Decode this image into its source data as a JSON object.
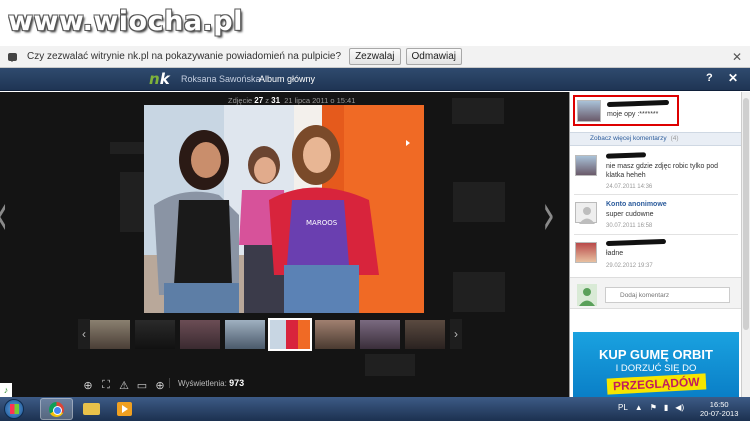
{
  "watermark": "www.wiocha.pl",
  "notification": {
    "message": "Czy zezwalać witrynie nk.pl na pokazywanie powiadomień na pulpicie?",
    "allow_label": "Zezwalaj",
    "deny_label": "Odmawiaj"
  },
  "header": {
    "logo_prefix": "n",
    "logo_suffix": "k",
    "user_name": "Roksana Sawońska",
    "album_label": "Album główny",
    "help_label": "?",
    "close_label": "✕"
  },
  "viewer": {
    "caption_prefix": "Zdjęcie",
    "current": "27",
    "caption_of": "z",
    "total": "31",
    "caption_date": "21 lipca 2011 o 15:41",
    "views_label": "Wyświetlenia:",
    "views_count": "973",
    "prev_arrow": "‹",
    "next_arrow": "›",
    "thumb_prev": "‹",
    "thumb_next": "›"
  },
  "comments": {
    "top": {
      "text": "moje opy :*******"
    },
    "more_label": "Zobacz więcej komentarzy",
    "more_count": "(4)",
    "items": [
      {
        "name": "",
        "text": "nie masz gdzie zdjęc robic tylko pod klatka heheh",
        "date": "24.07.2011 14:36"
      },
      {
        "name": "Konto anonimowe",
        "text": "super cudowne",
        "date": "30.07.2011 16:58"
      },
      {
        "name": "",
        "text": "ładne",
        "date": "29.02.2012 19:37"
      }
    ],
    "compose_placeholder": "Dodaj komentarz"
  },
  "ad": {
    "line1": "KUP GUMĘ ORBIT",
    "line2": "I DORZUĆ SIĘ DO",
    "line3": "PRZEGLĄDÓW"
  },
  "taskbar": {
    "lang": "PL",
    "time": "16:50",
    "date": "20-07-2013"
  },
  "colors": {
    "accent": "#2c5c9c",
    "nk_green": "#7fb23a",
    "highlight_border": "#d00000"
  }
}
